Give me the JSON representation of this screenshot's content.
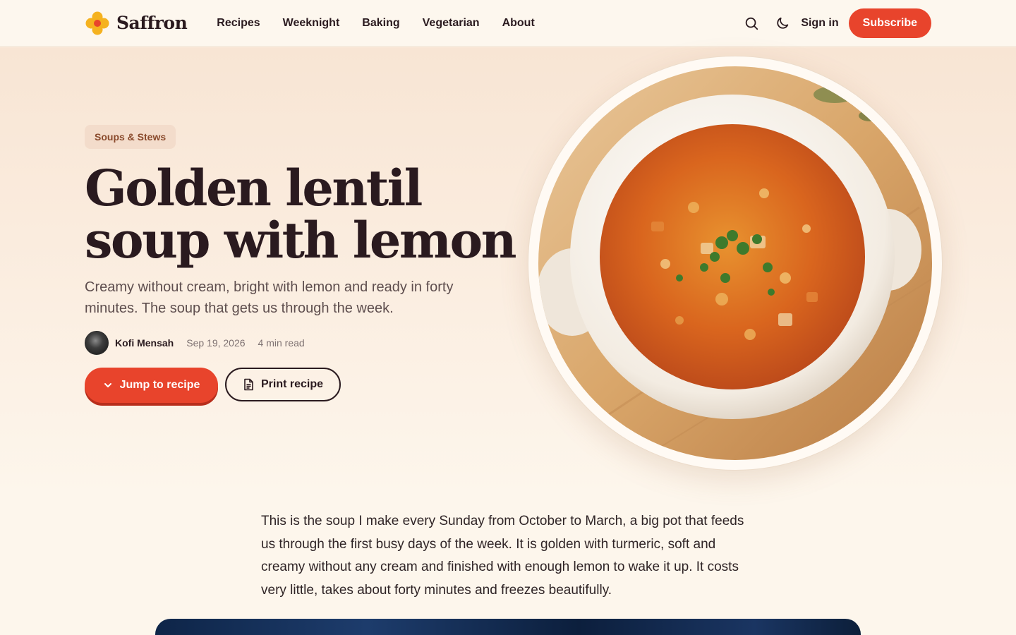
{
  "brand": {
    "name": "Saffron",
    "logo_icon": "flower-icon",
    "accent": "#e8442c",
    "logo_color": "#f5b21f"
  },
  "nav": {
    "items": [
      {
        "label": "Recipes"
      },
      {
        "label": "Weeknight"
      },
      {
        "label": "Baking"
      },
      {
        "label": "Vegetarian"
      },
      {
        "label": "About"
      }
    ]
  },
  "header": {
    "search_icon": "search-icon",
    "theme_icon": "moon-icon",
    "signin_label": "Sign in",
    "subscribe_label": "Subscribe"
  },
  "article": {
    "category": "Soups & Stews",
    "title_line1": "Golden lentil",
    "title_line2": "soup with lemon",
    "subtitle": "Creamy without cream, bright with lemon and ready in forty minutes. The soup that gets us through the week.",
    "author": "Kofi Mensah",
    "date": "Sep 19, 2026",
    "read_time": "4 min read",
    "jump_label": "Jump to recipe",
    "print_label": "Print recipe",
    "intro": "This is the soup I make every Sunday from October to March, a big pot that feeds us through the first busy days of the week. It is golden with turmeric, soft and creamy without any cream and finished with enough lemon to wake it up. It costs very little, takes about forty minutes and freezes beautifully."
  }
}
